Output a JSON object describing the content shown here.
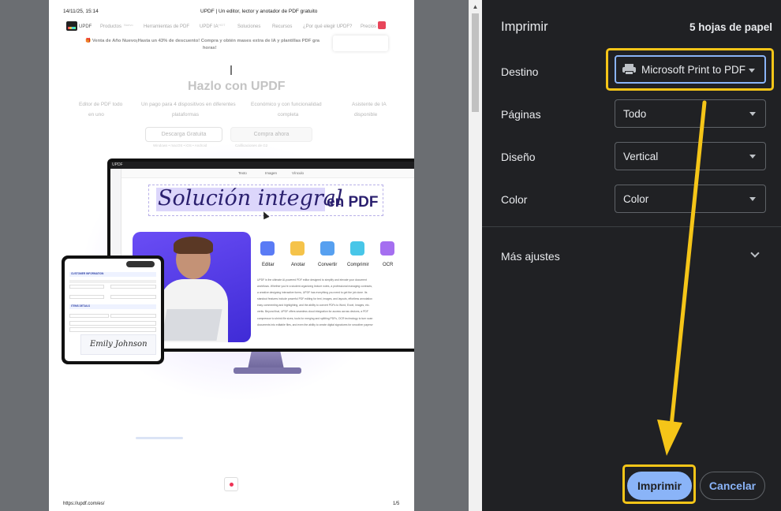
{
  "preview": {
    "header_date": "14/11/25, 15:14",
    "header_title": "UPDF | Un editor, lector y anotador de PDF gratuito",
    "brand": "UPDF",
    "nav": [
      "Productos",
      "Herramientas de PDF",
      "UPDF IA",
      "Soluciones",
      "Recursos",
      "¿Por qué elegir UPDF?",
      "Precios"
    ],
    "nav_badges": {
      "productos": "Nuevo",
      "updf_ia": "HOT"
    },
    "banner_line1": "🎁 Venta de Año Nuevo¡Hasta un 43% de descuento! Compra y obtén mases extra de IA y plantillas PDF gra",
    "banner_line2": "horas!",
    "hero_title": "Hazlo con UPDF",
    "features": [
      {
        "line1": "Editor de PDF todo",
        "line2": "en uno"
      },
      {
        "line1": "Un pago para 4 dispositivos en diferentes",
        "line2": "plataformas"
      },
      {
        "line1": "Económico y con funcionalidad",
        "line2": "completa"
      },
      {
        "line1": "Asistente de IA",
        "line2": "disponible"
      }
    ],
    "download_button": "Descarga Gratuita",
    "buy_button": "Compra ahora",
    "download_sub": "Windows • macOS • iOS • Android",
    "buy_sub": "Calificaciones de G2",
    "app_name": "UPDF",
    "toolbar_tabs": [
      "Texto",
      "Imagen",
      "Vínculo"
    ],
    "doc_title_script": "Solución integral",
    "doc_title_plain": "en PDF",
    "tools": [
      "Editar",
      "Anotar",
      "Convertir",
      "Comprimir",
      "OCR"
    ],
    "body_text": [
      "UPDF is the ultimate AI-powered PDF editor designed to simplify and elevate your document",
      "workflows. Whether you're a student organizing lecture notes, a professional managing contracts,",
      "a creative designing interactive forms, UPDF has everything you need to get the job done. Its",
      "standout features include powerful PDF editing for text, images, and layouts, effortless annotation",
      "easy commenting and highlighting, and the ability to convert PDFs to Word, Excel, Images, etc.",
      "vertis. Beyond that, UPDF offers seamless cloud integration for access across devices, a PDF",
      "compressor to shrink file sizes, tools for merging and splitting PDFs, OCR technology to turn scan",
      "documents into editable files, and even the ability to create digital signatures for smoother paperw"
    ],
    "form_title": "CUSTOMER INFORMATION",
    "form_section": "ITEMS DETAILS",
    "signature": "Emily Johnson",
    "footer_url": "https://updf.com/es/",
    "footer_page": "1/5"
  },
  "panel": {
    "title": "Imprimir",
    "sheets": "5 hojas de papel",
    "destination_label": "Destino",
    "destination_value": "Microsoft Print to PDF",
    "pages_label": "Páginas",
    "pages_value": "Todo",
    "layout_label": "Diseño",
    "layout_value": "Vertical",
    "color_label": "Color",
    "color_value": "Color",
    "more_settings": "Más ajustes",
    "print_button": "Imprimir",
    "cancel_button": "Cancelar"
  },
  "colors": {
    "panel_bg": "#202124",
    "highlight": "#f5c518",
    "print_button_bg": "#8ab4f8",
    "print_button_text": "#202124",
    "cancel_text": "#8ab4f8",
    "doc_title_ink": "#2a1f6e"
  }
}
